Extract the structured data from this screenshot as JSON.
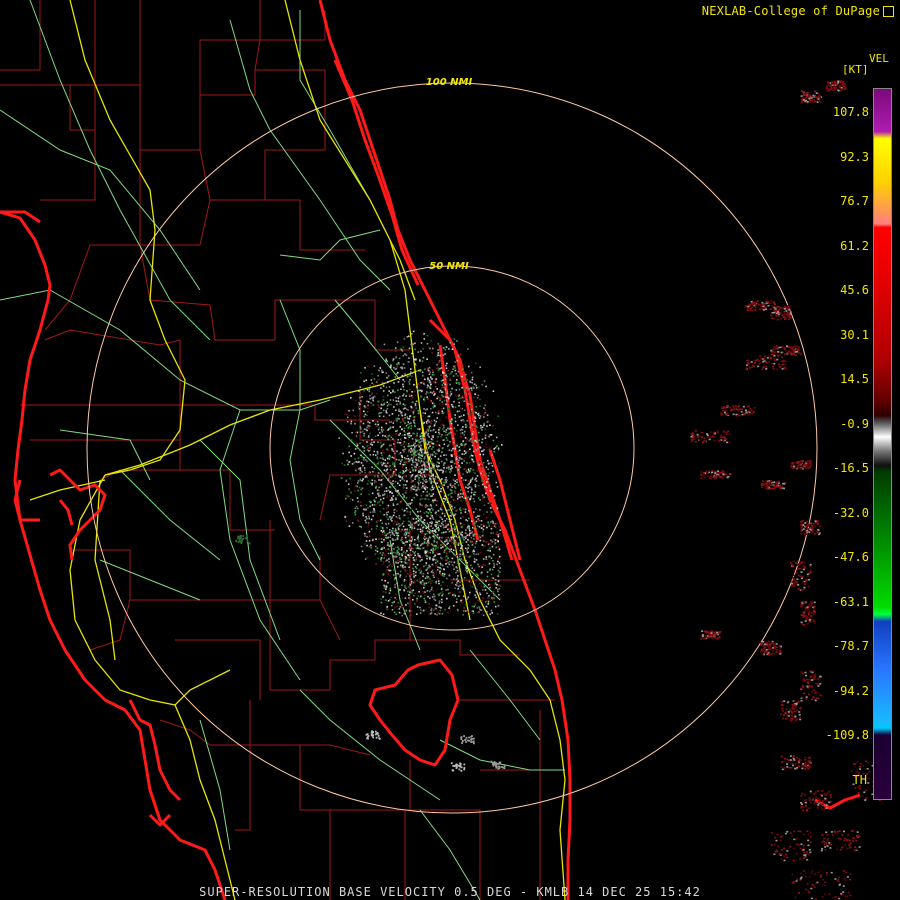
{
  "header": {
    "credit": "NEXLAB-College of DuPage"
  },
  "range_rings": {
    "inner_label": "50 NMI",
    "outer_label": "100 NMI"
  },
  "legend": {
    "product": "VEL",
    "unit": "[KT]",
    "values": [
      "107.8",
      "92.3",
      "76.7",
      "61.2",
      "45.6",
      "30.1",
      "14.5",
      "-0.9",
      "-16.5",
      "-32.0",
      "-47.6",
      "-63.1",
      "-78.7",
      "-94.2",
      "-109.8",
      "TH"
    ]
  },
  "footer": {
    "caption": "SUPER-RESOLUTION BASE VELOCITY 0.5 DEG - KMLB 14 DEC 25 15:42"
  },
  "colors": {
    "background": "#000000",
    "coast": "#ff1a1a",
    "county_lines": "#a01818",
    "highways": "#e6e600",
    "roads": "#7fdc7f",
    "range_rings": "#ffc9a0",
    "label_text": "#f2e600"
  }
}
